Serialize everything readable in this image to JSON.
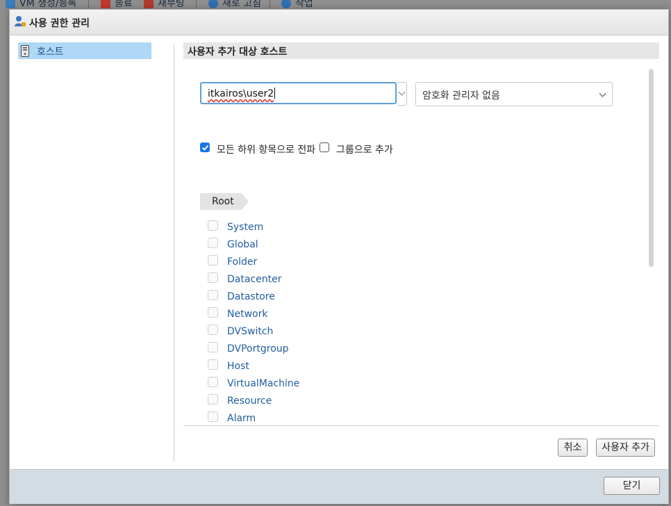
{
  "background_toolbar": {
    "items": [
      {
        "label": "VM 생성/등록",
        "icon": "vm-create-icon"
      },
      {
        "label": "종료",
        "icon": "power-off-icon"
      },
      {
        "label": "재부팅",
        "icon": "reboot-icon"
      },
      {
        "label": "새로 고침",
        "icon": "refresh-icon"
      },
      {
        "label": "작업",
        "icon": "gear-icon"
      }
    ]
  },
  "dialog": {
    "title": "사용 권한 관리",
    "title_icon": "user-permissions-icon"
  },
  "nav": {
    "items": [
      {
        "label": "호스트",
        "icon": "host-icon",
        "selected": true
      }
    ]
  },
  "section": {
    "header": "사용자 추가 대상 호스트"
  },
  "form": {
    "user_value": "itkairos\\user2",
    "role_select_value": "암호화 관리자 없음",
    "propagate_label": "모든 하위 항목으로 전파",
    "propagate_checked": true,
    "add_as_group_label": "그룹으로 추가",
    "add_as_group_checked": false
  },
  "privileges": {
    "root_label": "Root",
    "items": [
      "System",
      "Global",
      "Folder",
      "Datacenter",
      "Datastore",
      "Network",
      "DVSwitch",
      "DVPortgroup",
      "Host",
      "VirtualMachine",
      "Resource",
      "Alarm"
    ]
  },
  "actions": {
    "cancel_label": "취소",
    "add_user_label": "사용자 추가"
  },
  "footer": {
    "close_label": "닫기"
  },
  "colors": {
    "accent": "#1a73e8",
    "selected_nav_bg": "#aed8f6",
    "link_text": "#1f5c9e",
    "focus_border": "#5e9ed6"
  }
}
